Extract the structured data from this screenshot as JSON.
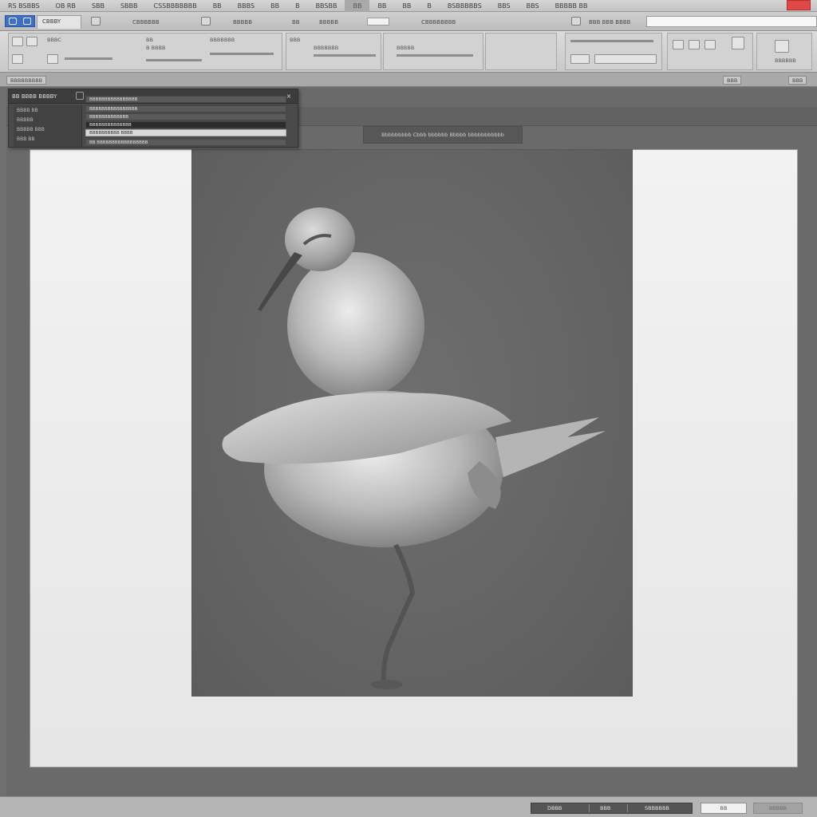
{
  "menubar": {
    "items": [
      "RS BSBBS",
      "OB RB",
      "SBB",
      "SBBB",
      "CSSBBBBBBB",
      "BB",
      "BBBS",
      "BB",
      "B",
      "BBSBB",
      "BB",
      "BB",
      "BB",
      "B",
      "BSBBBBBS",
      "BBS",
      "BBS",
      "BBBBB BB",
      "BB"
    ]
  },
  "tabs": {
    "doc_tab": "CBBBY",
    "labels": [
      "CBBBBBB",
      "BBBBB",
      "BB",
      "BBBBB",
      "CBBBBBBBB",
      "BBB"
    ],
    "search_text": "BBB BBB BBBB"
  },
  "ribbon": {
    "labels": [
      "BBBC",
      "BB",
      "B BBBB",
      "BBBBBBB",
      "BBB",
      "BBBBBBB",
      "BBBBB",
      "BBBBBB",
      "BBB"
    ]
  },
  "strip": {
    "left_label": "BBBBBBBBB",
    "right_chips": [
      "BBB",
      "BBB"
    ]
  },
  "panel": {
    "title": "BB BBBB BBBBY",
    "tabs": [
      "BBBB BB",
      "BBBBB",
      "BBBBB BBB",
      "BBB BB"
    ],
    "rows": [
      "BBBBBBBBBBBBBBBB",
      "BBBBBBBBBBBBBBBB",
      "BBBBBBBBBBBBB",
      "BBBBBBBBBBBBBB",
      "BBBBBBBBBB BBBB",
      "BB BBBBBBBBBBBBBBBBB"
    ],
    "close_glyph": "×"
  },
  "canvas": {
    "floating_label": "Bbbbbbbbb Cbbb bbbbbb Bbbbb bbbbbbbbbbb"
  },
  "bottombar": {
    "zoom_left": "DBBB",
    "zoom_mid": "BBB",
    "zoom_right": "SBBBBBB",
    "ok_label": "BB",
    "cancel_label": "BBBBB"
  },
  "colors": {
    "accent": "#3d6fc6",
    "close": "#e04848",
    "workspace": "#6a6a6a",
    "page": "#efefef"
  },
  "icons": [
    "app-icon",
    "close-icon",
    "search-icon",
    "panel-icon"
  ]
}
